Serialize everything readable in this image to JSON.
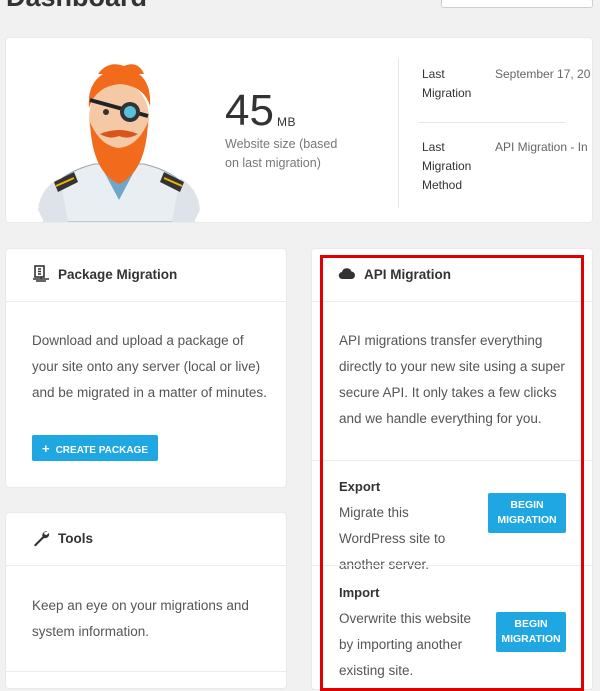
{
  "header": {
    "title": "Dashboard"
  },
  "hero": {
    "size_value": "45",
    "size_unit": "MB",
    "size_caption": "Website size (based on last migration)",
    "last_migration_label": "Last Migration",
    "last_migration_value": "September 17, 20",
    "last_method_label": "Last Migration Method",
    "last_method_value": "API Migration - In"
  },
  "package": {
    "title": "Package Migration",
    "description": "Download and upload a package of your site onto any server (local or live) and be migrated in a matter of minutes.",
    "button_label": "CREATE PACKAGE"
  },
  "tools": {
    "title": "Tools",
    "description": "Keep an eye on your migrations and system information."
  },
  "api": {
    "title": "API Migration",
    "description": "API migrations transfer everything directly to your new site using a super secure API. It only takes a few clicks and we handle everything for you.",
    "export_title": "Export",
    "export_desc": "Migrate this WordPress site to another server.",
    "export_button_line1": "BEGIN",
    "export_button_line2": "MIGRATION",
    "import_title": "Import",
    "import_desc": "Overwrite this website by importing another existing site.",
    "import_button_line1": "BEGIN",
    "import_button_line2": "MIGRATION"
  },
  "colors": {
    "accent": "#1ea7e1",
    "highlight": "#e00000"
  }
}
